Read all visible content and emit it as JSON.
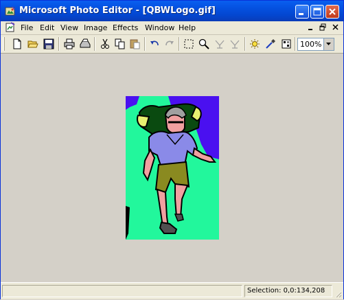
{
  "window": {
    "title": "Microsoft Photo Editor - [QBWLogo.gif]",
    "title_icon": "photo-editor-icon",
    "controls": [
      "minimize-icon",
      "maximize-icon",
      "close-icon"
    ]
  },
  "menubar": {
    "items": [
      "File",
      "Edit",
      "View",
      "Image",
      "Effects",
      "Window",
      "Help"
    ],
    "doc_controls": [
      "doc-minimize-icon",
      "doc-restore-icon",
      "doc-close-icon"
    ]
  },
  "toolbar": {
    "buttons": [
      "new-icon",
      "open-icon",
      "save-icon",
      "print-icon",
      "scan-icon",
      "cut-icon",
      "copy-icon",
      "paste-icon",
      "undo-icon",
      "redo-icon",
      "select-icon",
      "zoom-icon",
      "set-transparent-icon",
      "transparent-off-icon",
      "brightness-icon",
      "eyedropper-icon",
      "properties-icon"
    ],
    "zoom": {
      "value": "100%"
    }
  },
  "document": {
    "image_name": "QBWLogo.gif"
  },
  "status": {
    "left": "",
    "selection": "Selection: 0,0:134,208"
  },
  "colors": {
    "titlebar": "#0553e3",
    "workspace": "#d4d0c8",
    "image_green": "#22f79c",
    "image_purple": "#4a10f0"
  }
}
